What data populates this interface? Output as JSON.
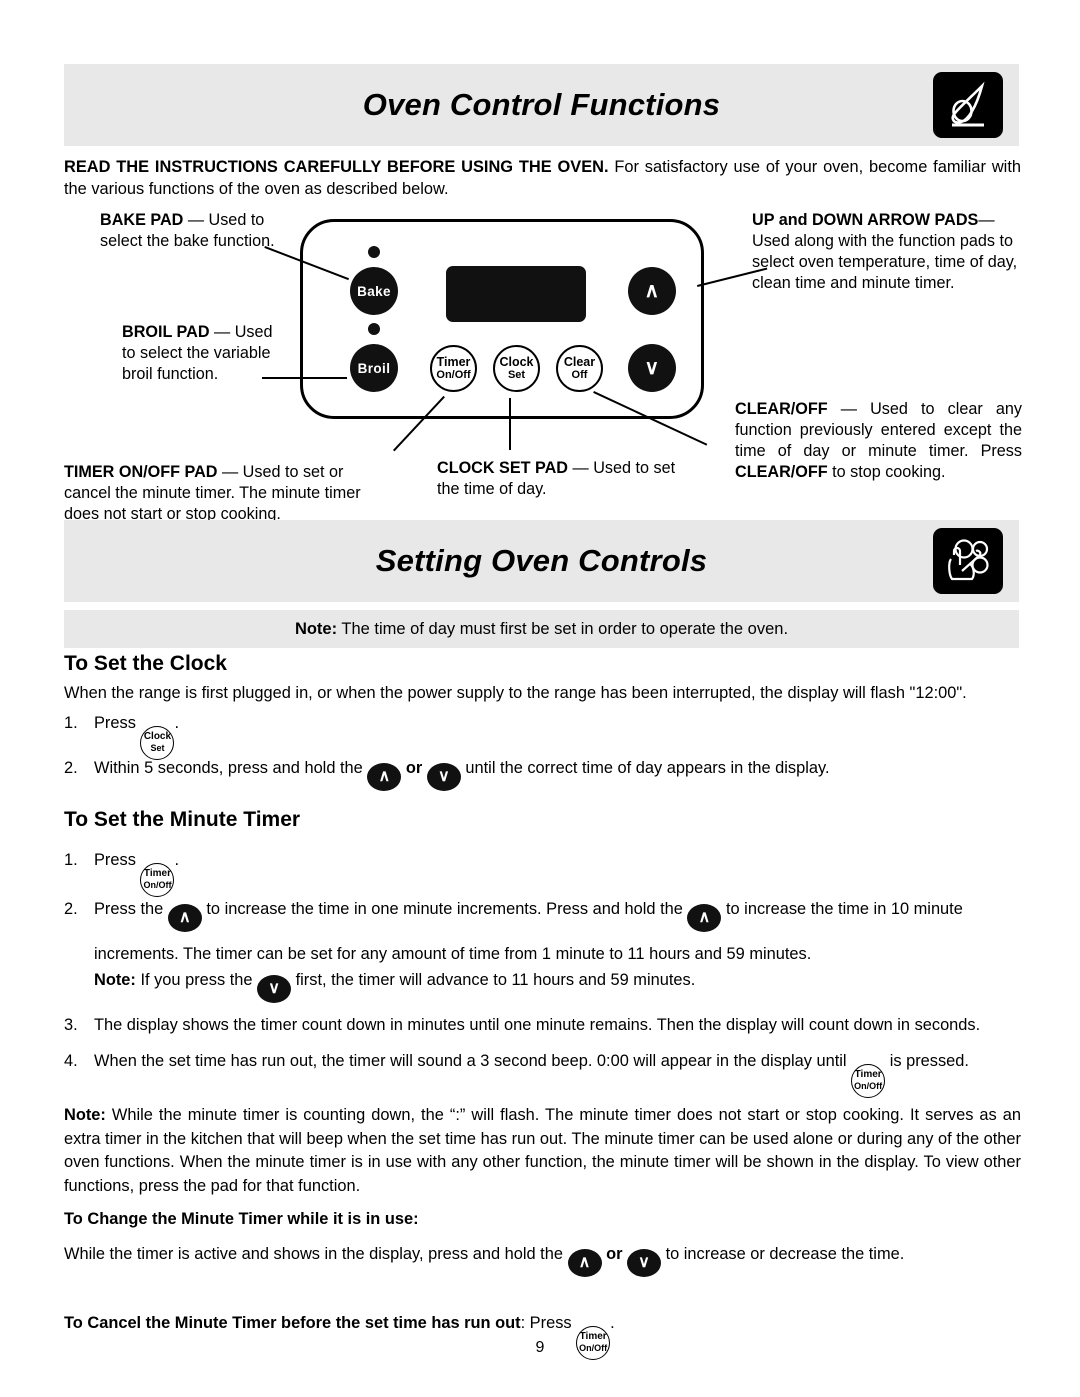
{
  "sections": {
    "oven_control_functions": {
      "title": "Oven Control Functions",
      "logo_name": "finger-press-icon",
      "intro_bold": "READ THE INSTRUCTIONS CAREFULLY BEFORE USING THE OVEN.",
      "intro_rest": " For satisfactory use of your oven, become familiar with the various functions of the oven as described below."
    },
    "setting_oven_controls": {
      "title": "Setting Oven Controls",
      "logo_name": "hand-on-controls-icon",
      "note_bold": "Note:",
      "note_rest": " The time of day must first be set in order to operate the oven."
    }
  },
  "control_panel": {
    "pads": [
      {
        "name": "bake",
        "label": "Bake",
        "style": "dark",
        "indicator": true
      },
      {
        "name": "broil",
        "label": "Broil",
        "style": "dark",
        "indicator": true
      },
      {
        "name": "timer-on-off",
        "line1": "Timer",
        "line2": "On/Off",
        "style": "light"
      },
      {
        "name": "clock-set",
        "line1": "Clock",
        "line2": "Set",
        "style": "light"
      },
      {
        "name": "clear-off",
        "line1": "Clear",
        "line2": "Off",
        "style": "light"
      },
      {
        "name": "up-arrow",
        "label": "∧",
        "style": "dark"
      },
      {
        "name": "down-arrow",
        "label": "∨",
        "style": "dark"
      }
    ],
    "display_name": "oven-display-window"
  },
  "callouts": {
    "bake_pad": {
      "bold": "BAKE PAD",
      "rest": " — Used to select the bake function."
    },
    "broil_pad": {
      "bold": "BROIL PAD",
      "rest": " — Used to select the variable broil function."
    },
    "timer_pad": {
      "bold": "TIMER ON/OFF PAD",
      "rest": " — Used to set or cancel the minute timer. The minute timer does not start or stop cooking."
    },
    "clock_pad": {
      "bold": "CLOCK SET PAD",
      "rest": " — Used to set the time of day."
    },
    "arrow_pads": {
      "bold": "UP and DOWN ARROW PADS",
      "rest": "— Used along with the function pads to select oven temperature, time of day, clean time and minute timer."
    },
    "clear_off": {
      "bold1": "CLEAR/OFF",
      "rest1": " — Used to clear any function previously entered except the time of day or minute timer. Press ",
      "bold2": "CLEAR/OFF",
      "rest2": " to stop cooking."
    }
  },
  "clock_section": {
    "heading": "To Set the Clock",
    "intro": "When the range is first plugged in, or when the power supply to the range has been interrupted, the display will flash \"12:00\".",
    "step1_num": "1.",
    "step1_pre": "Press ",
    "step1_post": ".",
    "step2_num": "2.",
    "step2_pre": "Within 5 seconds, press and hold the ",
    "step2_or": " or ",
    "step2_post": " until the correct time of day appears in the display."
  },
  "timer_section": {
    "heading": "To Set the Minute Timer",
    "step1_num": "1.",
    "step1_pre": "Press ",
    "step1_post": ".",
    "step2_num": "2.",
    "step2_a": "Press the ",
    "step2_b": " to increase the time in one minute increments. Press and hold the ",
    "step2_c": " to increase the time in 10 minute increments. The timer can be set for any amount of time from 1 minute to 11 hours and 59 minutes.",
    "step2_note_bold": "Note:",
    "step2_note_a": " If you press the ",
    "step2_note_b": " first, the timer will advance to 11 hours and 59 minutes.",
    "step3_num": "3.",
    "step3_text": "The display shows the timer count down in minutes until one minute remains. Then the display will count down in seconds.",
    "step4_num": "4.",
    "step4_a": "When the set time has run out, the timer will sound a 3 second beep. 0:00 will appear in the display until ",
    "step4_b": " is pressed."
  },
  "final_note": {
    "bold": "Note:",
    "rest": " While the minute timer is counting down, the “:” will flash. The minute timer does not start or stop cooking. It serves as an extra timer in the kitchen that will beep when the set time has run out. The minute timer can be used alone or during any of the other oven functions. When the minute timer is in use with any other function, the minute timer will be shown in the display. To view other functions, press the pad for that function."
  },
  "change_timer": {
    "heading": "To Change the Minute Timer while it is in use:",
    "pre": "While the timer is active and shows in the display, press and hold the ",
    "or": " or ",
    "post": " to increase or decrease the time."
  },
  "cancel_timer": {
    "bold": "To Cancel the Minute Timer before the set time has run out",
    "mid": ": Press ",
    "post": "."
  },
  "page_number": "9",
  "colors": {
    "band_background": "#e8e8e8",
    "pad_dark": "#111111",
    "page_background": "#ffffff"
  }
}
